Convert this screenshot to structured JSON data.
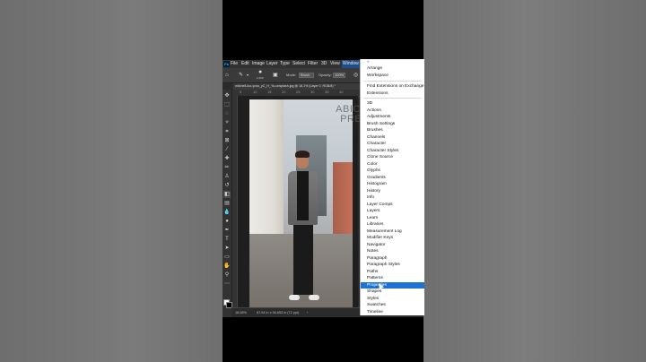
{
  "menubar": {
    "logo": "Ps",
    "items": [
      "File",
      "Edit",
      "Image",
      "Layer",
      "Type",
      "Select",
      "Filter",
      "3D",
      "View",
      "Window"
    ]
  },
  "options": {
    "size_value": "1,000",
    "mode_label": "Mode:",
    "mode_value": "Brush",
    "opacity_label": "Opacity:",
    "opacity_value": "100%"
  },
  "document": {
    "tab_title": "mitchell-luo-yvoo_yC_H_Yu-unsplash.jpg @ 18.1% (Layer 0, RGB/8) *"
  },
  "ruler": {
    "numbers": [
      "5",
      "10",
      "15",
      "20",
      "25",
      "30",
      "35",
      "40"
    ]
  },
  "watermark": {
    "line1": "ABICREATESS",
    "line2": "PRESENTER"
  },
  "status": {
    "zoom": "18.08%",
    "dimensions": "67.94 in x 96.653 in (72 ppi)"
  },
  "window_menu": {
    "items": [
      {
        "label": "Arrange"
      },
      {
        "label": "Workspace"
      },
      {
        "label": "Find Extensions on Exchange..."
      },
      {
        "label": "Extensions"
      },
      {
        "label": "3D"
      },
      {
        "label": "Actions"
      },
      {
        "label": "Adjustments"
      },
      {
        "label": "Brush Settings"
      },
      {
        "label": "Brushes"
      },
      {
        "label": "Channels"
      },
      {
        "label": "Character"
      },
      {
        "label": "Character Styles"
      },
      {
        "label": "Clone Source"
      },
      {
        "label": "Color"
      },
      {
        "label": "Glyphs"
      },
      {
        "label": "Gradients"
      },
      {
        "label": "Histogram"
      },
      {
        "label": "History"
      },
      {
        "label": "Info"
      },
      {
        "label": "Layer Comps"
      },
      {
        "label": "Layers"
      },
      {
        "label": "Learn"
      },
      {
        "label": "Libraries"
      },
      {
        "label": "Measurement Log"
      },
      {
        "label": "Modifier Keys"
      },
      {
        "label": "Navigator"
      },
      {
        "label": "Notes"
      },
      {
        "label": "Paragraph"
      },
      {
        "label": "Paragraph Styles"
      },
      {
        "label": "Paths"
      },
      {
        "label": "Patterns"
      },
      {
        "label": "Properties",
        "highlighted": true
      },
      {
        "label": "Shapes"
      },
      {
        "label": "Styles"
      },
      {
        "label": "Swatches"
      },
      {
        "label": "Timeline"
      }
    ]
  },
  "colors": {
    "highlight": "#1e73d2",
    "foreground": "#ffffff",
    "background": "#000000"
  }
}
